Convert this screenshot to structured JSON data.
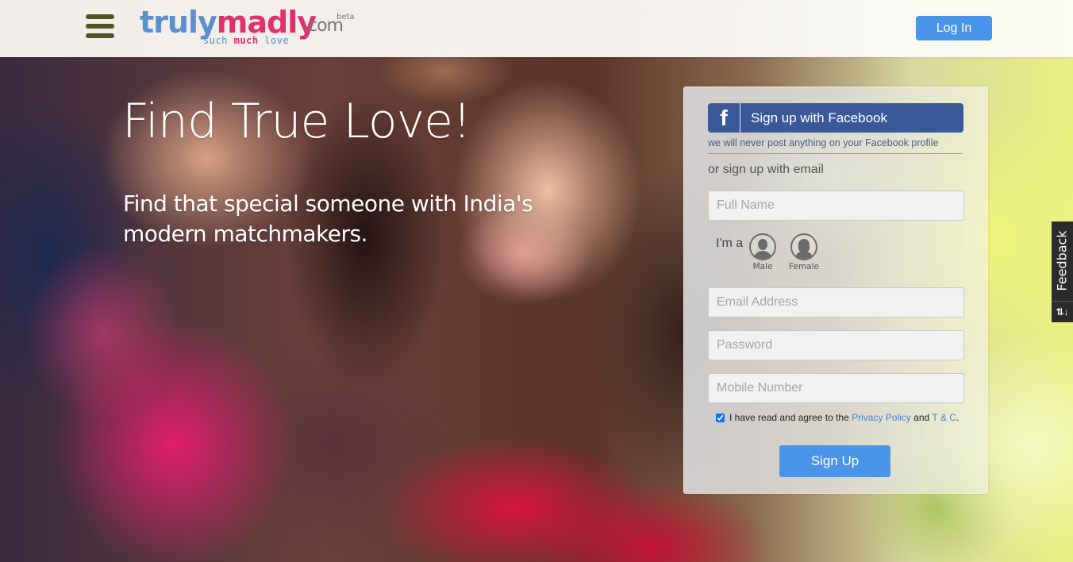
{
  "header": {
    "logo": {
      "part1": "truly",
      "part2": "madly",
      "suffix": ".com",
      "badge": "beta",
      "tagline": [
        "such",
        "much",
        "love"
      ]
    },
    "menu_icon": "hamburger-menu-icon",
    "login_label": "Log In"
  },
  "hero": {
    "title": "Find True Love!",
    "subtitle": "Find that special someone with India's modern matchmakers."
  },
  "signup": {
    "facebook": {
      "icon": "f",
      "label": "Sign up with Facebook",
      "note": "we will never post anything on your Facebook profile"
    },
    "or_email": "or sign up with email",
    "fields": {
      "full_name": {
        "placeholder": "Full Name",
        "value": ""
      },
      "email": {
        "placeholder": "Email Address",
        "value": ""
      },
      "password": {
        "placeholder": "Password",
        "value": ""
      },
      "mobile": {
        "placeholder": "Mobile Number",
        "value": ""
      }
    },
    "gender": {
      "prompt": "I'm a",
      "options": [
        {
          "label": "Male",
          "icon": "male-avatar-icon"
        },
        {
          "label": "Female",
          "icon": "female-avatar-icon"
        }
      ]
    },
    "terms": {
      "checked": true,
      "prefix": "I have read and agree to the ",
      "privacy_link": "Privacy Policy",
      "middle": " and ",
      "tc_link": "T & C",
      "suffix": "."
    },
    "submit_label": "Sign Up"
  },
  "feedback": {
    "label": "Feedback",
    "icon": "⇅↓"
  },
  "colors": {
    "brand_blue": "#5b8fd0",
    "brand_pink": "#e0306e",
    "button_blue": "#4a94ea",
    "facebook_blue": "#3b5998",
    "link_blue": "#4a7fd0"
  }
}
